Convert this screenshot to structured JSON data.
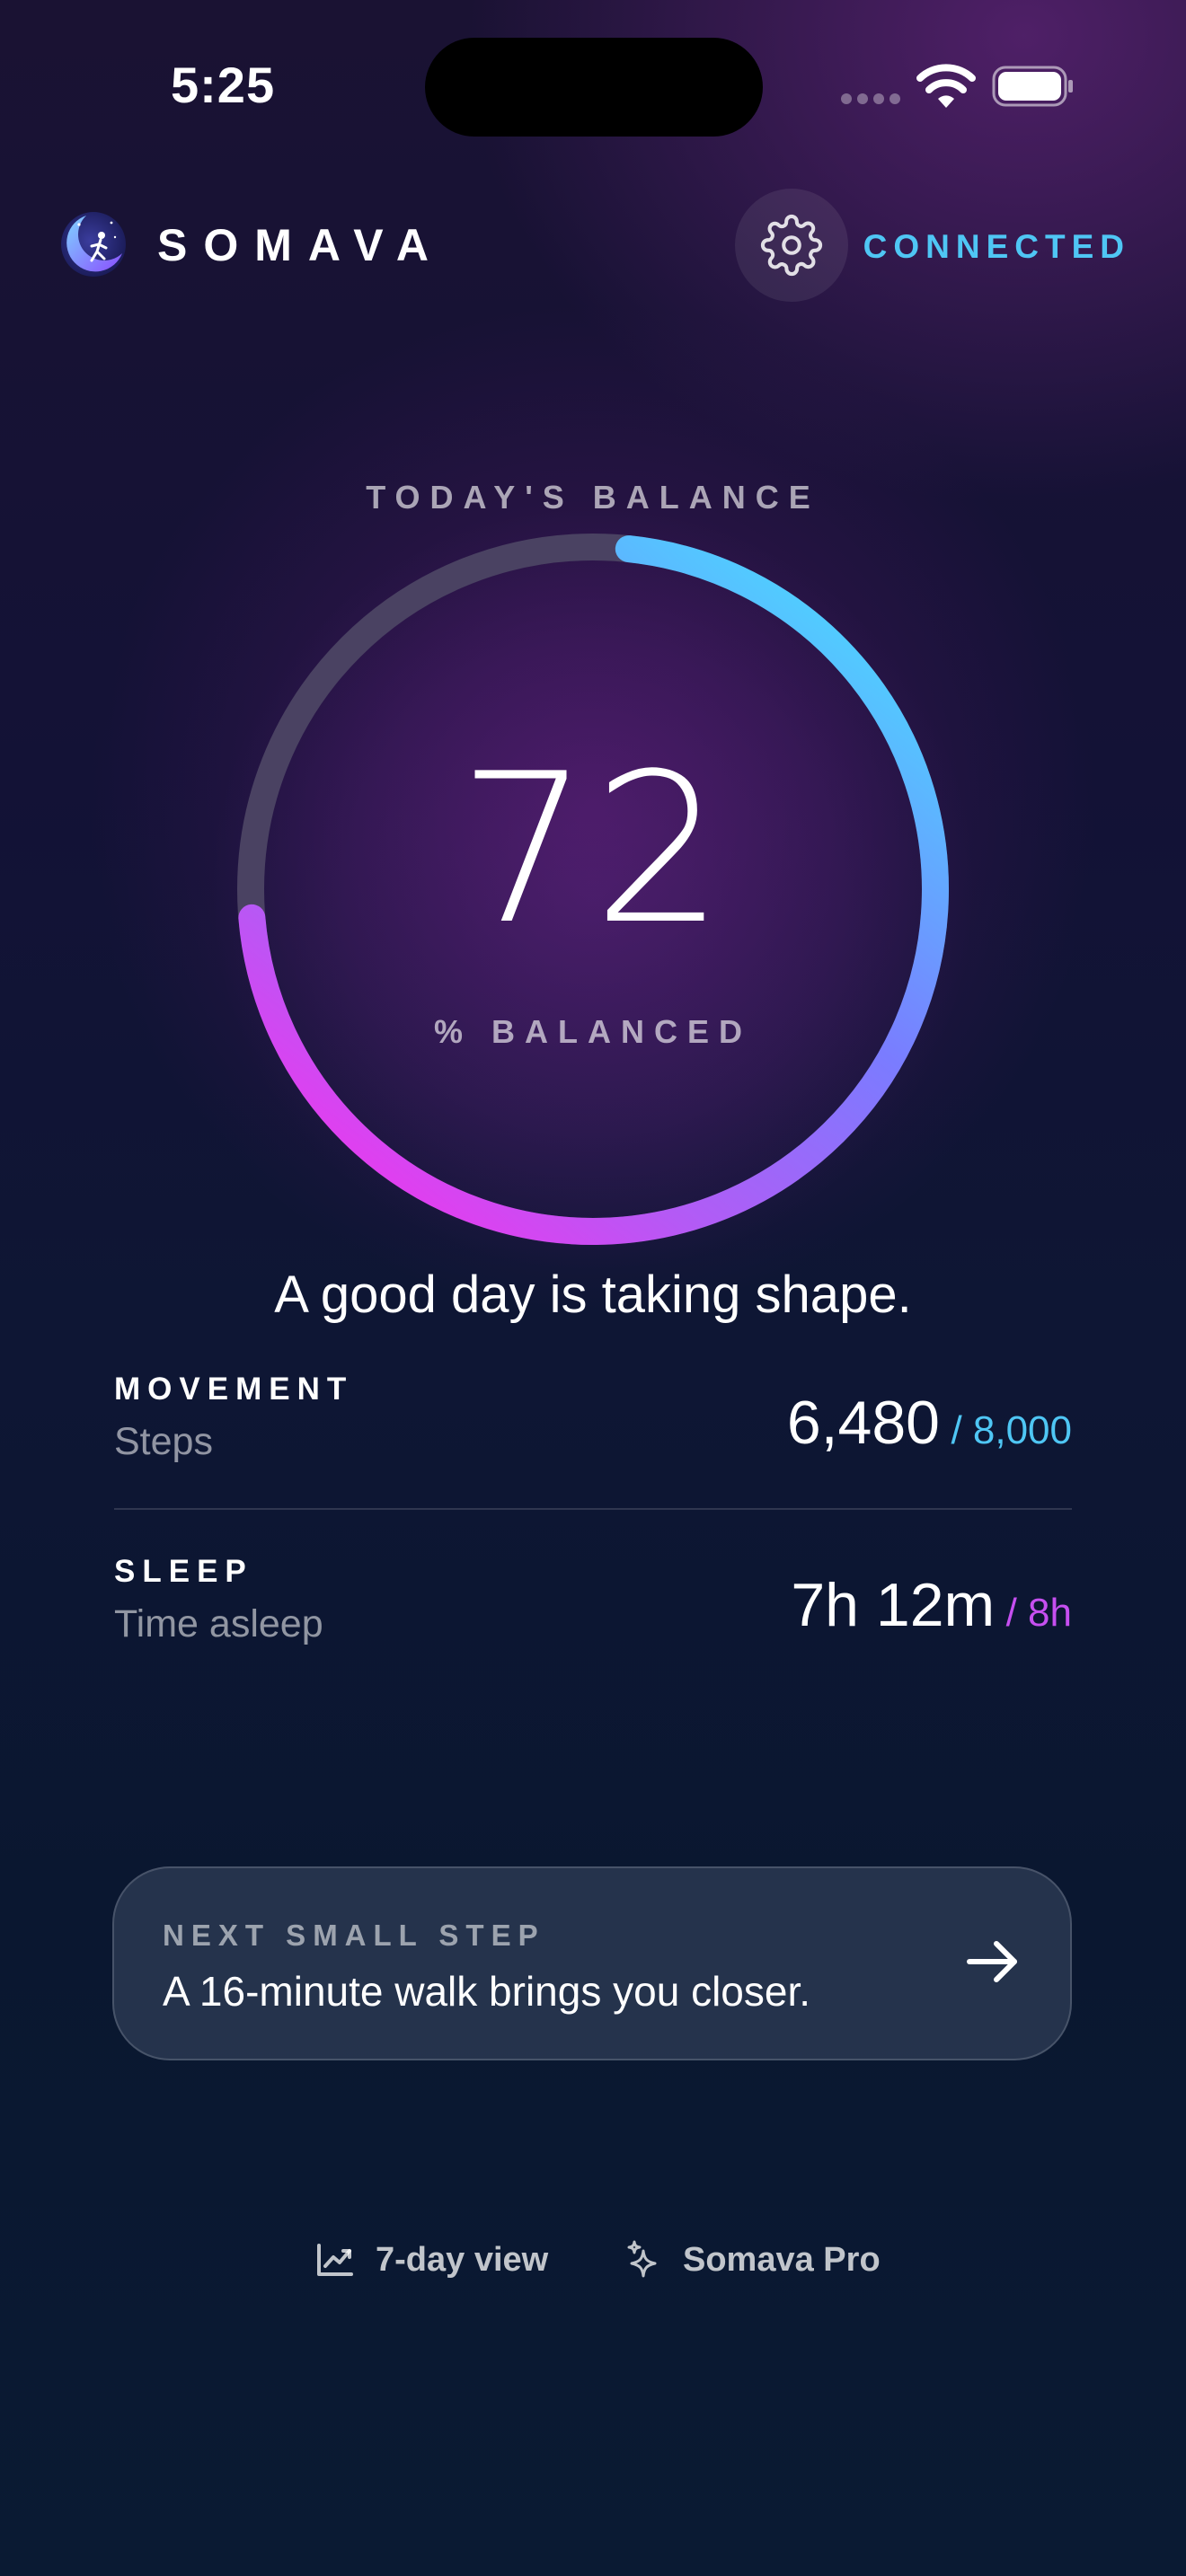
{
  "status_bar": {
    "time": "5:25"
  },
  "header": {
    "brand": "SOMAVA",
    "connection_status": "CONNECTED"
  },
  "balance": {
    "label": "TODAY'S BALANCE",
    "value": "72",
    "percent": 72,
    "unit_label": "% BALANCED",
    "tagline": "A good day is taking shape."
  },
  "metrics": [
    {
      "title": "MOVEMENT",
      "subtitle": "Steps",
      "value": "6,480",
      "goal": "/ 8,000",
      "goal_color": "#4fc6f4"
    },
    {
      "title": "SLEEP",
      "subtitle": "Time asleep",
      "value": "7h 12m",
      "goal": "/ 8h",
      "goal_color": "#c64ff0"
    }
  ],
  "next_step": {
    "label": "NEXT SMALL STEP",
    "text": "A 16-minute walk brings you closer.",
    "icon": "arrow-right-icon"
  },
  "footer_links": [
    {
      "label": "7-day view",
      "icon": "chart-trend-icon"
    },
    {
      "label": "Somava Pro",
      "icon": "sparkle-icon"
    }
  ],
  "colors": {
    "accent_cyan": "#4fc6f4",
    "accent_magenta": "#d943f0",
    "ring_track": "#4a4262"
  },
  "icons": [
    "wifi-icon",
    "battery-icon",
    "logo-icon",
    "gear-icon",
    "arrow-right-icon",
    "chart-trend-icon",
    "sparkle-icon"
  ]
}
